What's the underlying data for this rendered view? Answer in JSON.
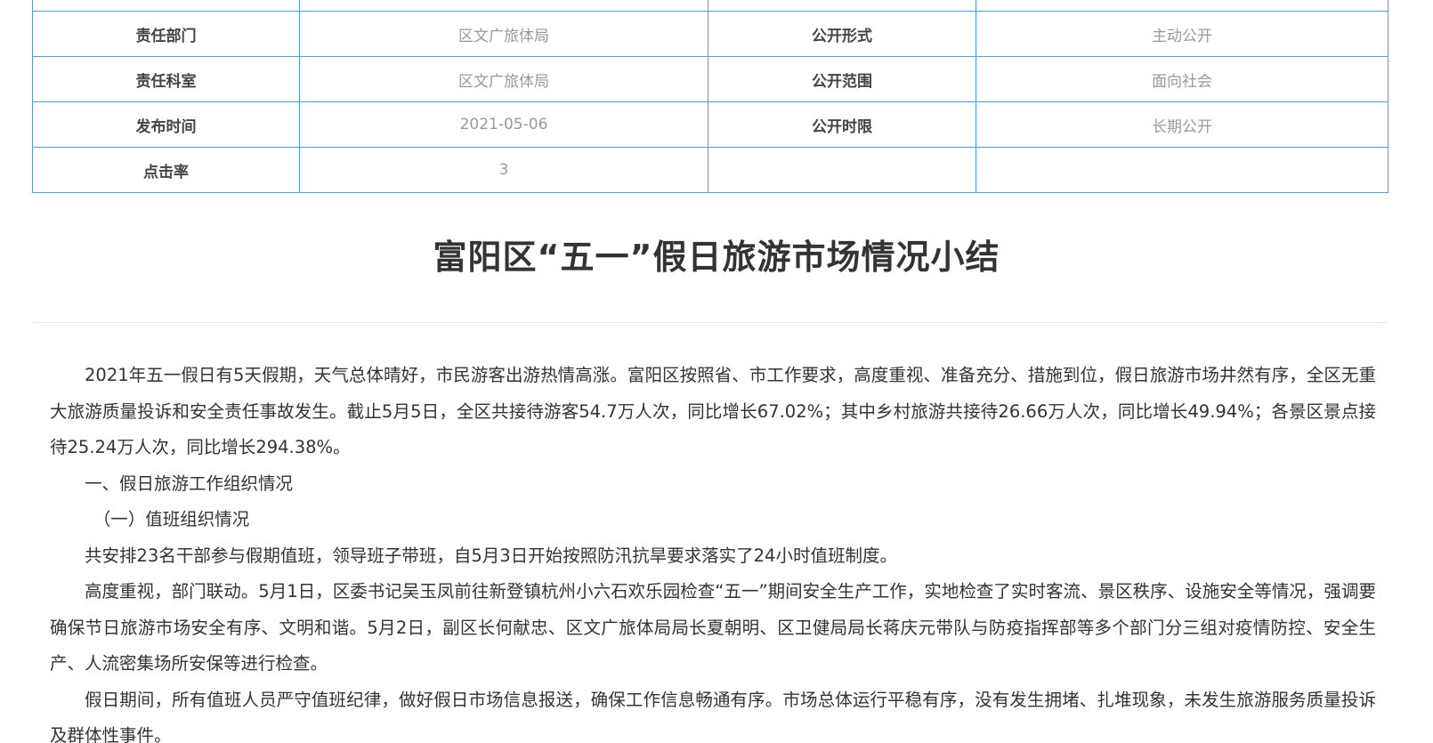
{
  "info_table": {
    "rows": [
      {
        "label1": "",
        "value1": "",
        "label2": "",
        "value2": ""
      },
      {
        "label1": "责任部门",
        "value1": "区文广旅体局",
        "label2": "公开形式",
        "value2": "主动公开"
      },
      {
        "label1": "责任科室",
        "value1": "区文广旅体局",
        "label2": "公开范围",
        "value2": "面向社会"
      },
      {
        "label1": "发布时间",
        "value1": "2021-05-06",
        "label2": "公开时限",
        "value2": "长期公开"
      },
      {
        "label1": "点击率",
        "value1": "3",
        "label2": "",
        "value2": ""
      }
    ]
  },
  "article": {
    "title": "富阳区“五一”假日旅游市场情况小结",
    "paragraphs": [
      "2021年五一假日有5天假期，天气总体晴好，市民游客出游热情高涨。富阳区按照省、市工作要求，高度重视、准备充分、措施到位，假日旅游市场井然有序，全区无重大旅游质量投诉和安全责任事故发生。截止5月5日，全区共接待游客54.7万人次，同比增长67.02%；其中乡村旅游共接待26.66万人次，同比增长49.94%；各景区景点接待25.24万人次，同比增长294.38%。",
      "一、假日旅游工作组织情况",
      "（一）值班组织情况",
      "共安排23名干部参与假期值班，领导班子带班，自5月3日开始按照防汛抗旱要求落实了24小时值班制度。",
      "高度重视，部门联动。5月1日，区委书记吴玉凤前往新登镇杭州小六石欢乐园检查“五一”期间安全生产工作，实地检查了实时客流、景区秩序、设施安全等情况，强调要确保节日旅游市场安全有序、文明和谐。5月2日，副区长何献忠、区文广旅体局局长夏朝明、区卫健局局长蒋庆元带队与防疫指挥部等多个部门分三组对疫情防控、安全生产、人流密集场所安保等进行检查。",
      "假日期间，所有值班人员严守值班纪律，做好假日市场信息报送，确保工作信息畅通有序。市场总体运行平稳有序，没有发生拥堵、扎堆现象，未发生旅游服务质量投诉及群体性事件。"
    ]
  }
}
